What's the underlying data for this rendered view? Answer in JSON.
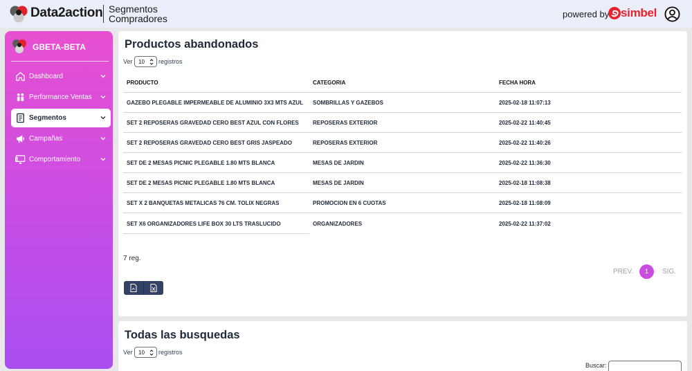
{
  "header": {
    "brand": "Data2action",
    "page_title": "Segmentos Compradores",
    "powered_by": "powered by",
    "partner": "simbel"
  },
  "sidebar": {
    "account": "GBETA-BETA",
    "items": [
      {
        "label": "Dashboard",
        "icon": "home-icon"
      },
      {
        "label": "Performance Ventas",
        "icon": "people-icon"
      },
      {
        "label": "Segmentos",
        "icon": "document-icon",
        "active": true
      },
      {
        "label": "Campañas",
        "icon": "megaphone-icon"
      },
      {
        "label": "Comportamiento",
        "icon": "monitor-icon"
      }
    ]
  },
  "abandoned": {
    "title": "Productos abandonados",
    "ver": "Ver",
    "page_size": "10",
    "registros": "registros",
    "columns": [
      "PRODUCTO",
      "CATEGORIA",
      "FECHA HORA"
    ],
    "rows": [
      [
        "GAZEBO PLEGABLE IMPERMEABLE DE ALUMINIO 3X3 MTS AZUL",
        "SOMBRILLAS Y GAZEBOS",
        "2025-02-18 11:07:13"
      ],
      [
        "SET 2 REPOSERAS GRAVEDAD CERO BEST AZUL CON FLORES",
        "REPOSERAS EXTERIOR",
        "2025-02-22 11:40:45"
      ],
      [
        "SET 2 REPOSERAS GRAVEDAD CERO BEST GRIS JASPEADO",
        "REPOSERAS EXTERIOR",
        "2025-02-22 11:40:26"
      ],
      [
        "SET DE 2 MESAS PICNIC PLEGABLE 1.80 MTS BLANCA",
        "MESAS DE JARDIN",
        "2025-02-22 11:36:30"
      ],
      [
        "SET DE 2 MESAS PICNIC PLEGABLE 1.80 MTS BLANCA",
        "MESAS DE JARDIN",
        "2025-02-18 11:08:38"
      ],
      [
        "SET X 2 BANQUETAS METALICAS 76 CM. TOLIX NEGRAS",
        "PROMOCION EN 6 CUOTAS",
        "2025-02-18 11:08:09"
      ],
      [
        "SET X6 ORGANIZADORES LIFE BOX 30 LTS TRASLUCIDO",
        "ORGANIZADORES",
        "2025-02-22 11:37:02"
      ]
    ],
    "count": "7 reg.",
    "pagination": {
      "prev": "PREV.",
      "current": "1",
      "next": "SIG."
    }
  },
  "searches": {
    "title": "Todas las busquedas",
    "ver": "Ver",
    "page_size": "10",
    "registros": "registros",
    "search_label": "Buscar:"
  },
  "colors": {
    "sidebar_top": "#e84fd0",
    "sidebar_bottom": "#a94ef0",
    "accent": "#c94ee0",
    "export_button": "#334166",
    "simbel_red": "#e8232f"
  }
}
